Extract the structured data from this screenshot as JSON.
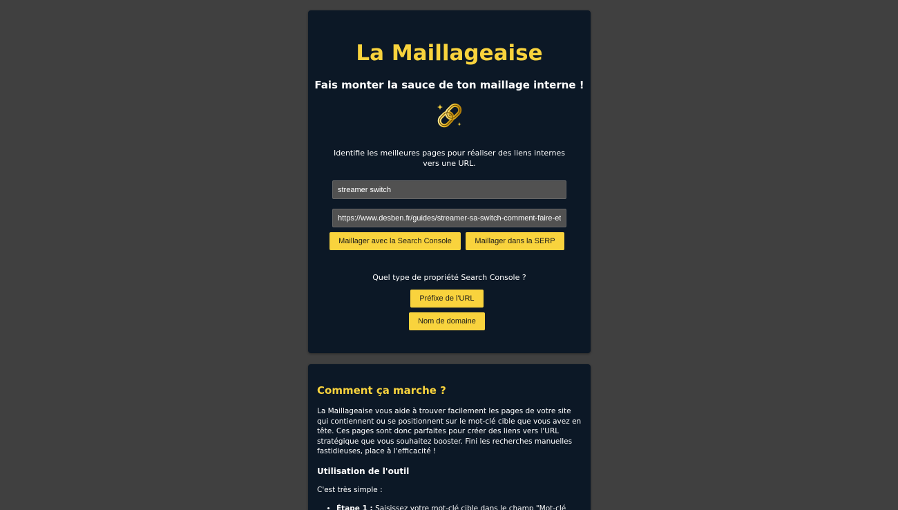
{
  "tool": {
    "title": "La Maillageaise",
    "subtitle": "Fais monter la sauce de ton maillage interne !",
    "logo_icon": "gold-chain-link-icon",
    "description": "Identifie les meilleures pages pour réaliser des liens internes vers une URL.",
    "keyword_input": {
      "value": "streamer switch"
    },
    "url_input": {
      "value": "https://www.desben.fr/guides/streamer-sa-switch-comment-faire-et-"
    },
    "buttons": {
      "search_console": "Maillager avec la Search Console",
      "serp": "Maillager dans la SERP"
    },
    "property_question": "Quel type de propriété Search Console ?",
    "property_buttons": {
      "prefix": "Préfixe de l'URL",
      "domain": "Nom de domaine"
    }
  },
  "info": {
    "title": "Comment ça marche ?",
    "intro": "La Maillageaise vous aide à trouver facilement les pages de votre site qui contiennent ou se positionnent sur le mot-clé cible que vous avez en tête. Ces pages sont donc parfaites pour créer des liens vers l'URL stratégique que vous souhaitez booster. Fini les recherches manuelles fastidieuses, place à l'efficacité !",
    "usage_title": "Utilisation de l'outil",
    "usage_intro": "C'est très simple :",
    "steps": [
      {
        "label": "Étape 1 :",
        "text": " Saisissez votre mot-clé cible dans le champ \"Mot-clé cible\"."
      }
    ]
  },
  "colors": {
    "background": "#404040",
    "card": "#0c1826",
    "accent": "#f9d33d",
    "input": "#515151"
  }
}
